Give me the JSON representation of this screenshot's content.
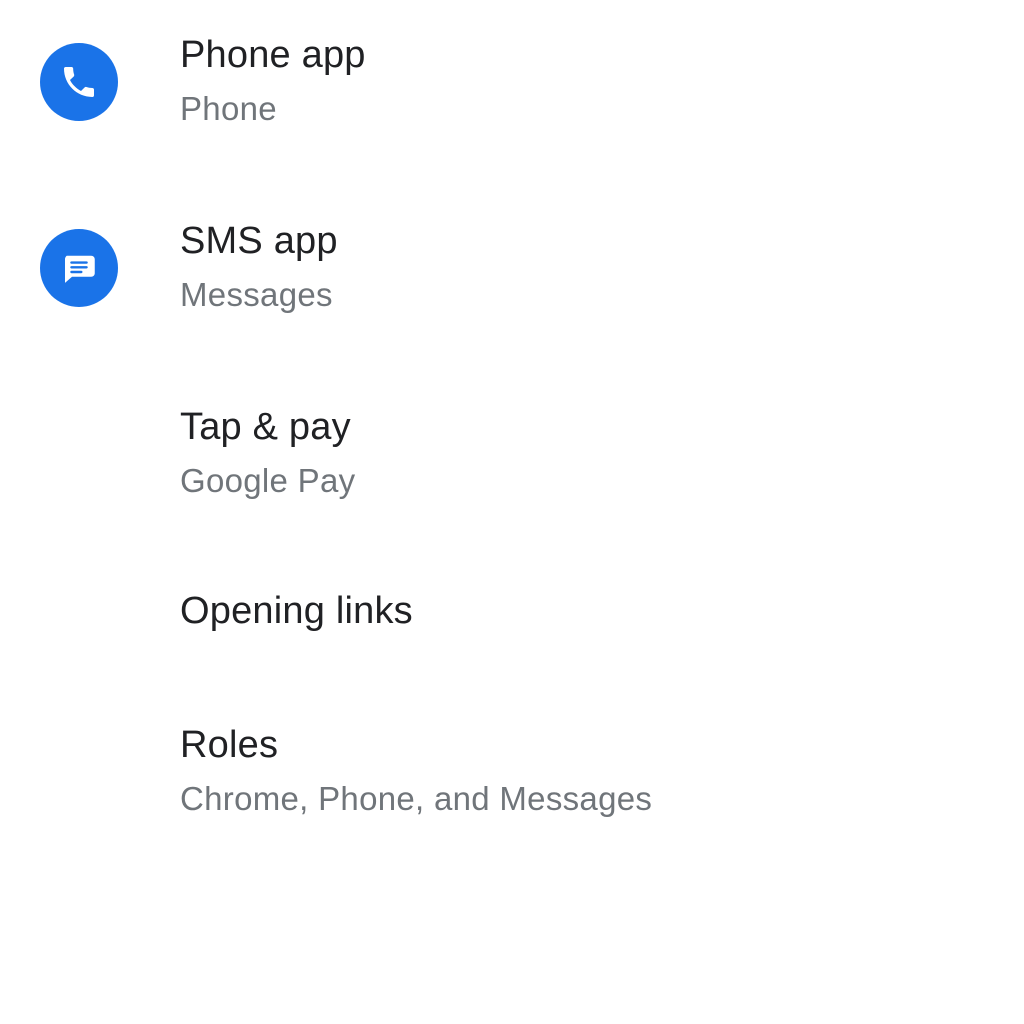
{
  "settings": {
    "items": [
      {
        "title": "Phone app",
        "subtitle": "Phone",
        "icon": "phone-icon"
      },
      {
        "title": "SMS app",
        "subtitle": "Messages",
        "icon": "messages-icon"
      },
      {
        "title": "Tap & pay",
        "subtitle": "Google Pay"
      },
      {
        "title": "Opening links"
      },
      {
        "title": "Roles",
        "subtitle": "Chrome, Phone, and Messages"
      }
    ]
  },
  "colors": {
    "accent": "#1a73e8",
    "title_text": "#202124",
    "subtitle_text": "#70757a",
    "background": "#ffffff"
  }
}
